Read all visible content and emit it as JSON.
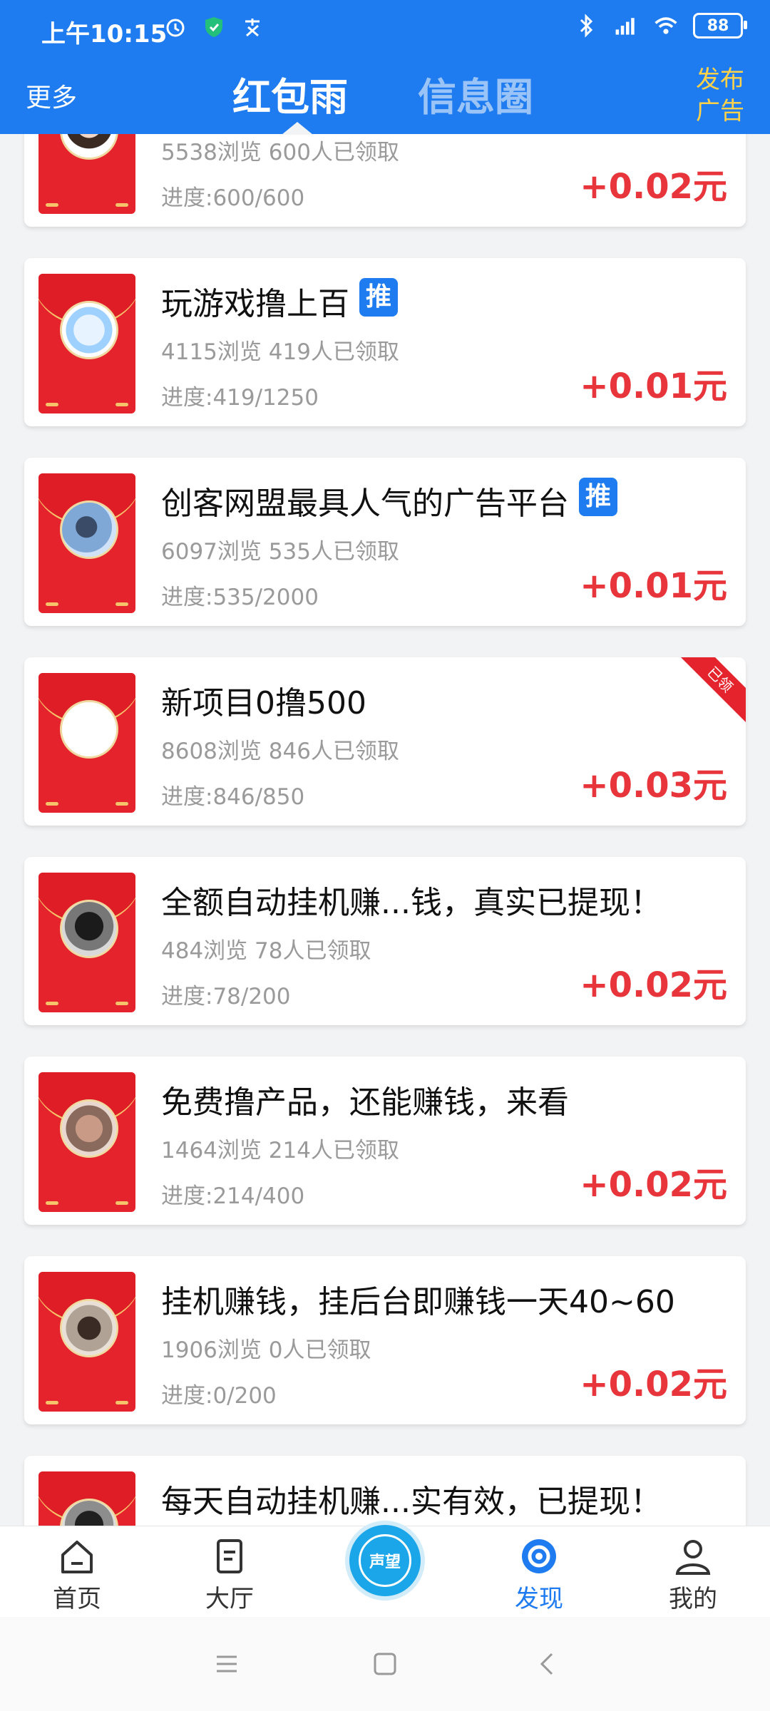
{
  "status_bar": {
    "time": "上午10:15",
    "battery": "88"
  },
  "header": {
    "more": "更多",
    "tabs": [
      {
        "label": "红包雨",
        "active": true
      },
      {
        "label": "信息圈",
        "active": false
      }
    ],
    "publish_ad": "发布广告",
    "background_color": "#1f7cf0",
    "accent_color": "#ffd24a"
  },
  "cards": [
    {
      "title": "",
      "recommended": false,
      "views": "5538浏览",
      "claimed": "600人已领取",
      "progress": "进度:600/600",
      "reward": "+0.02元",
      "claimed_flag": false
    },
    {
      "title": "玩游戏撸上百",
      "recommended": true,
      "views": "4115浏览",
      "claimed": "419人已领取",
      "progress": "进度:419/1250",
      "reward": "+0.01元",
      "claimed_flag": false
    },
    {
      "title": "创客网盟最具人气的广告平台",
      "recommended": true,
      "views": "6097浏览",
      "claimed": "535人已领取",
      "progress": "进度:535/2000",
      "reward": "+0.01元",
      "claimed_flag": false
    },
    {
      "title": "新项目0撸500",
      "recommended": false,
      "views": "8608浏览",
      "claimed": "846人已领取",
      "progress": "进度:846/850",
      "reward": "+0.03元",
      "claimed_flag": true,
      "ribbon": "已领"
    },
    {
      "title": "全额自动挂机赚...钱，真实已提现！",
      "recommended": false,
      "views": "484浏览",
      "claimed": "78人已领取",
      "progress": "进度:78/200",
      "reward": "+0.02元",
      "claimed_flag": false
    },
    {
      "title": "免费撸产品，还能赚钱，来看",
      "recommended": false,
      "views": "1464浏览",
      "claimed": "214人已领取",
      "progress": "进度:214/400",
      "reward": "+0.02元",
      "claimed_flag": false
    },
    {
      "title": "挂机赚钱，挂后台即赚钱一天40~60",
      "recommended": false,
      "views": "1906浏览",
      "claimed": "0人已领取",
      "progress": "进度:0/200",
      "reward": "+0.02元",
      "claimed_flag": false
    },
    {
      "title": "每天自动挂机赚...实有效，已提现！",
      "recommended": false,
      "views": "",
      "claimed": "",
      "progress": "",
      "reward": "",
      "claimed_flag": false
    }
  ],
  "recommend_badge": "推",
  "bottom_nav": {
    "items": [
      {
        "label": "首页",
        "icon": "home-icon"
      },
      {
        "label": "大厅",
        "icon": "hall-icon"
      },
      {
        "label": "发现",
        "icon": "discover-icon",
        "active": true
      },
      {
        "label": "我的",
        "icon": "profile-icon"
      }
    ],
    "center_label": "声望"
  }
}
